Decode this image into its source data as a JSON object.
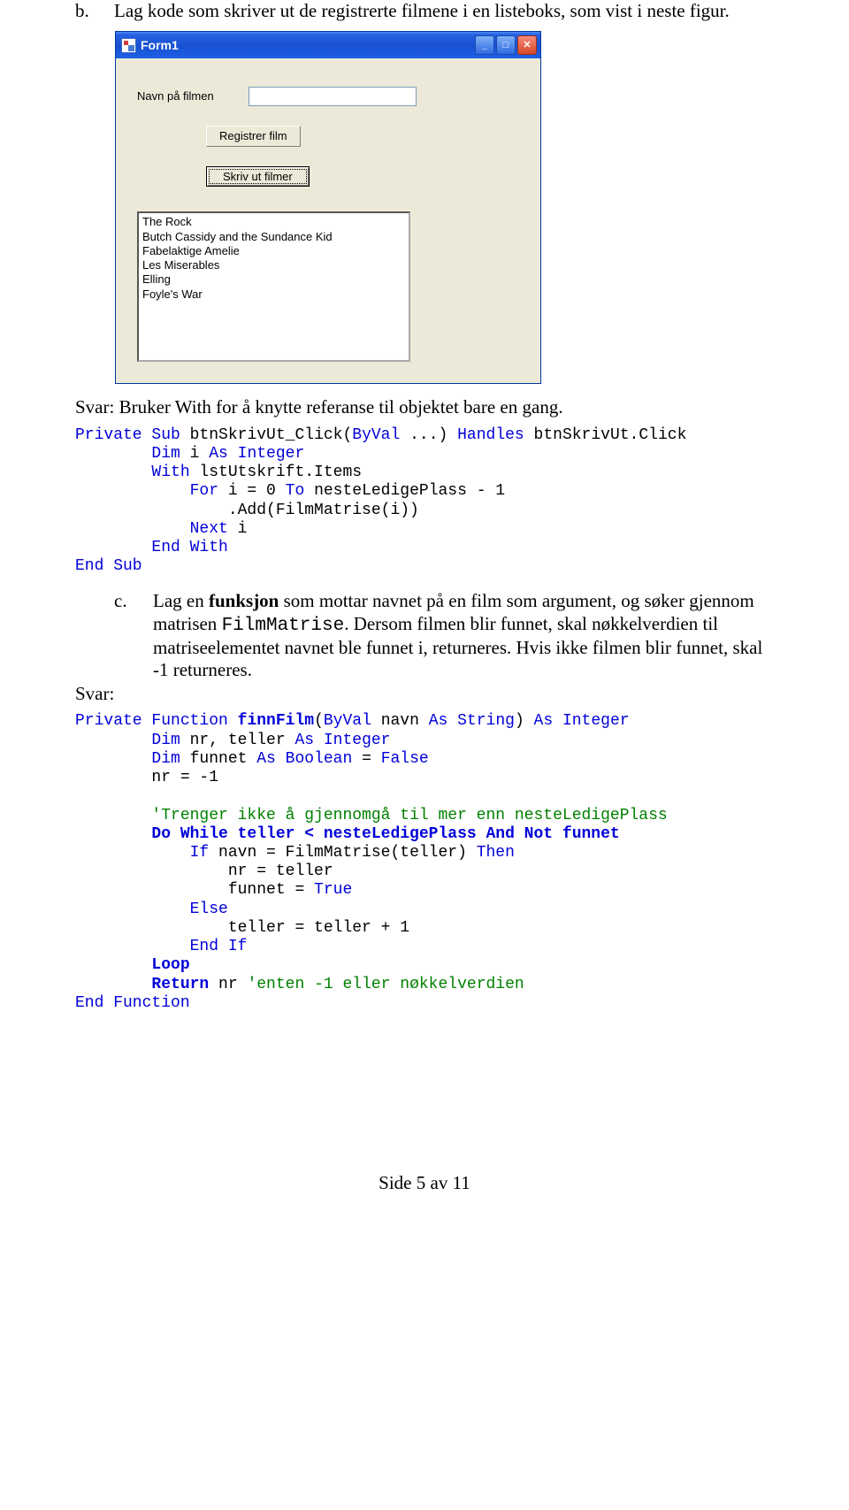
{
  "section_b": {
    "marker": "b.",
    "text": "Lag kode som skriver ut de registrerte filmene i en listeboks, som vist i neste figur."
  },
  "window": {
    "title": "Form1",
    "label_film": "Navn på filmen",
    "btn_register": "Registrer film",
    "btn_print": "Skriv ut filmer",
    "list_items": [
      "The Rock",
      "Butch Cassidy and the Sundance Kid",
      "Fabelaktige Amelie",
      "Les Miserables",
      "Elling",
      "Foyle's War"
    ]
  },
  "svar1_intro": "Svar: Bruker With for å knytte referanse til objektet bare en gang.",
  "code1": {
    "l1a": "Private",
    "l1b": " Sub",
    "l1c": " btnSkrivUt_Click(",
    "l1d": "ByVal",
    "l1e": " ...) ",
    "l1f": "Handles",
    "l1g": " btnSkrivUt.Click",
    "l2a": "        Dim",
    "l2b": " i ",
    "l2c": "As",
    "l2d": " Integer",
    "l3a": "        With",
    "l3b": " lstUtskrift.Items",
    "l4a": "            For",
    "l4b": " i = 0 ",
    "l4c": "To",
    "l4d": " nesteLedigePlass - 1",
    "l5": "                .Add(FilmMatrise(i))",
    "l6a": "            Next",
    "l6b": " i",
    "l7": "        End With",
    "l8": "End Sub"
  },
  "section_c": {
    "marker": "c.",
    "before_bold": "Lag en ",
    "bold": "funksjon",
    "after_bold": " som mottar navnet på en film som argument, og søker gjennom matrisen ",
    "mono": "FilmMatrise",
    "rest": ". Dersom filmen blir funnet, skal nøkkelverdien til matriseelementet navnet ble funnet i, returneres. Hvis ikke filmen blir funnet, skal -1 returneres."
  },
  "svar2": "Svar:",
  "code2": {
    "l1a": "Private",
    "l1b": " Function",
    "l1c": " finnFilm",
    "l1d": "(",
    "l1e": "ByVal",
    "l1f": " navn ",
    "l1g": "As",
    "l1h": " String",
    "l1i": ") ",
    "l1j": "As",
    "l1k": " Integer",
    "l2a": "        Dim",
    "l2b": " nr, teller ",
    "l2c": "As",
    "l2d": " Integer",
    "l3a": "        Dim",
    "l3b": " funnet ",
    "l3c": "As",
    "l3d": " Boolean",
    "l3e": " = ",
    "l3f": "False",
    "l4": "        nr = -1",
    "blank": " ",
    "l5": "        'Trenger ikke å gjennomgå til mer enn nesteLedigePlass",
    "l6a": "        Do While teller < nesteLedigePlass And Not funnet",
    "l7a": "            If",
    "l7b": " navn = FilmMatrise(teller) ",
    "l7c": "Then",
    "l8": "                nr = teller",
    "l9a": "                funnet = ",
    "l9b": "True",
    "l10": "            Else",
    "l11": "                teller = teller + 1",
    "l12": "            End If",
    "l13": "        Loop",
    "l14a": "        Return",
    "l14b": " nr ",
    "l14c": "'enten -1 eller nøkkelverdien",
    "l15": "End Function"
  },
  "footer": "Side 5 av 11"
}
